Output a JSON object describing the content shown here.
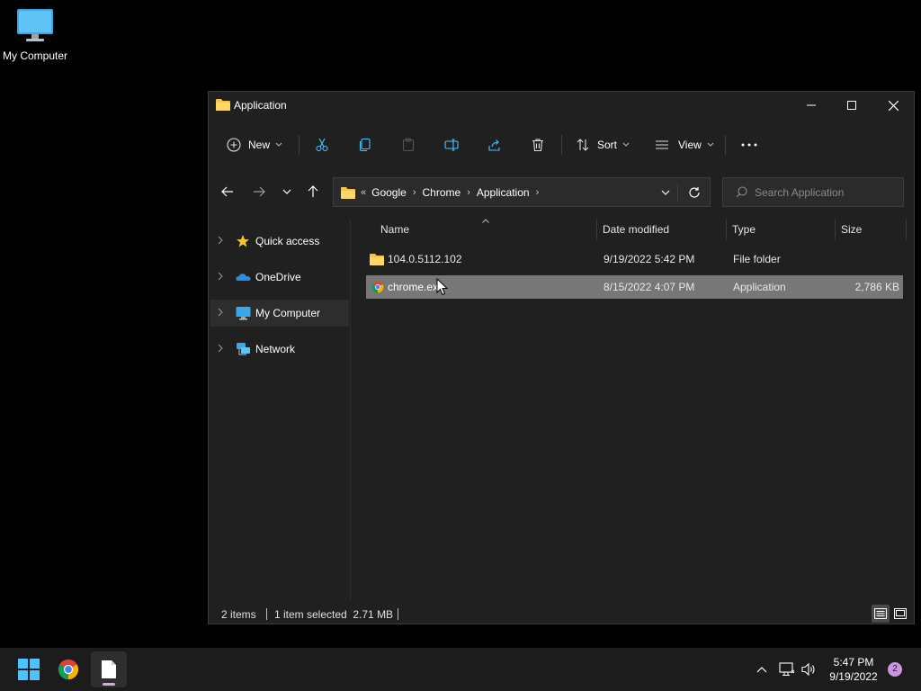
{
  "desktop": {
    "icon_label": "My Computer"
  },
  "window": {
    "title": "Application",
    "toolbar": {
      "new_label": "New",
      "sort_label": "Sort",
      "view_label": "View"
    },
    "breadcrumb": [
      "Google",
      "Chrome",
      "Application"
    ],
    "search_placeholder": "Search Application",
    "nav": [
      {
        "label": "Quick access",
        "icon": "star-icon"
      },
      {
        "label": "OneDrive",
        "icon": "cloud-icon"
      },
      {
        "label": "My Computer",
        "icon": "monitor-icon",
        "selected": true
      },
      {
        "label": "Network",
        "icon": "network-icon"
      }
    ],
    "columns": {
      "name": "Name",
      "date": "Date modified",
      "type": "Type",
      "size": "Size"
    },
    "files": [
      {
        "name": "104.0.5112.102",
        "date": "9/19/2022 5:42 PM",
        "type": "File folder",
        "size": "",
        "icon": "folder-icon"
      },
      {
        "name": "chrome.ex",
        "date": "8/15/2022 4:07 PM",
        "type": "Application",
        "size": "2,786 KB",
        "icon": "chrome-icon",
        "selected": true
      }
    ],
    "status": {
      "count": "2 items",
      "selection": "1 item selected  2.71 MB"
    }
  },
  "taskbar": {
    "time": "5:47 PM",
    "date": "9/19/2022",
    "notification_count": "2"
  },
  "colors": {
    "selection": "#777777",
    "window_bg": "#202020",
    "taskbar_bg": "#1c1c1c",
    "folder": "#f3c54b",
    "accent": "#4cc2ff"
  }
}
